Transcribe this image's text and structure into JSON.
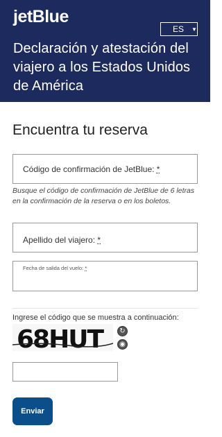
{
  "header": {
    "logo_text": "jetBlue",
    "language": "ES",
    "title": "Declaración y atestación del viajero a los Estados Unidos de América"
  },
  "main": {
    "section_title": "Encuentra tu reserva",
    "confirmation_field": {
      "label": "Código de confirmación de JetBlue: ",
      "required_mark": "*",
      "value": ""
    },
    "confirmation_hint": "Busque el código de confirmación de JetBlue de 6 letras en la confirmación de la reserva o en los boletos.",
    "last_name_field": {
      "label": "Apellido del viajero: ",
      "required_mark": "*",
      "value": ""
    },
    "departure_date_field": {
      "label": "Fecha de salida del vuelo: ",
      "required_mark": "*",
      "value": ""
    },
    "captcha": {
      "instruction": "Ingrese el código que se muestra a continuación:",
      "image_text": "68HUT",
      "refresh_icon": "refresh-icon",
      "audio_icon": "audio-icon",
      "value": ""
    },
    "submit_label": "Enviar"
  },
  "colors": {
    "header_bg": "#1d2a5e",
    "button_bg": "#0b4f8a"
  }
}
